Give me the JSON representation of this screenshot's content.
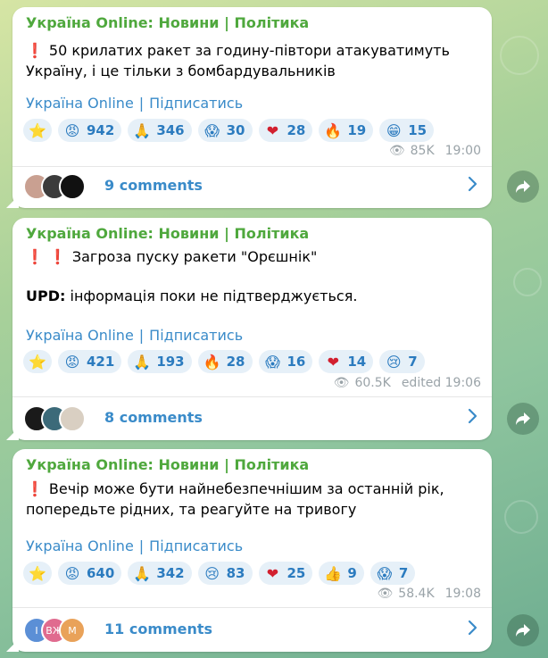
{
  "colors": {
    "accent": "#3a8bc9",
    "channel_green": "#4fa83d",
    "exclamation_red": "#d21e2b"
  },
  "posts": [
    {
      "header": "Україна Online: Новини | Політика",
      "line1": "50 крилатих ракет за годину-півтори атакуватимуть",
      "line2": "Україну, і це тільки з бомбардувальників",
      "link_channel": "Україна Online",
      "link_subscribe": "Підписатись",
      "reactions": [
        {
          "icon": "star-icon",
          "count": ""
        },
        {
          "icon": "angry-face-icon",
          "count": "942"
        },
        {
          "icon": "folded-hands-icon",
          "count": "346"
        },
        {
          "icon": "screaming-face-icon",
          "count": "30"
        },
        {
          "icon": "heart-icon",
          "count": "28"
        },
        {
          "icon": "fire-icon",
          "count": "19"
        },
        {
          "icon": "grin-face-icon",
          "count": "15"
        }
      ],
      "views": "85K",
      "time": "19:00",
      "comments": "9 comments"
    },
    {
      "header": "Україна Online: Новини | Політика",
      "line1": "Загроза пуску ракети \"Орєшнік\"",
      "upd_label": "UPD:",
      "upd_text": " інформація поки не підтверджується.",
      "link_channel": "Україна Online",
      "link_subscribe": "Підписатись",
      "reactions": [
        {
          "icon": "star-icon",
          "count": ""
        },
        {
          "icon": "angry-face-icon",
          "count": "421"
        },
        {
          "icon": "folded-hands-icon",
          "count": "193"
        },
        {
          "icon": "fire-icon",
          "count": "28"
        },
        {
          "icon": "screaming-face-icon",
          "count": "16"
        },
        {
          "icon": "heart-icon",
          "count": "14"
        },
        {
          "icon": "crying-face-icon",
          "count": "7"
        }
      ],
      "views": "60.5K",
      "time": "edited 19:06",
      "comments": "8 comments"
    },
    {
      "header": "Україна Online: Новини | Політика",
      "line1": "Вечір може бути найнебезпечнішим за останній рік,",
      "line2": "попередьте рідних, та реагуйте на тривогу",
      "link_channel": "Україна Online",
      "link_subscribe": "Підписатись",
      "reactions": [
        {
          "icon": "star-icon",
          "count": ""
        },
        {
          "icon": "angry-face-icon",
          "count": "640"
        },
        {
          "icon": "folded-hands-icon",
          "count": "342"
        },
        {
          "icon": "crying-face-icon",
          "count": "83"
        },
        {
          "icon": "heart-icon",
          "count": "25"
        },
        {
          "icon": "thumbs-up-icon",
          "count": "9"
        },
        {
          "icon": "screaming-face-icon",
          "count": "7"
        }
      ],
      "views": "58.4K",
      "time": "19:08",
      "comments": "11 comments",
      "avatar_letters": [
        "І",
        "ВЖ",
        "М"
      ]
    }
  ]
}
